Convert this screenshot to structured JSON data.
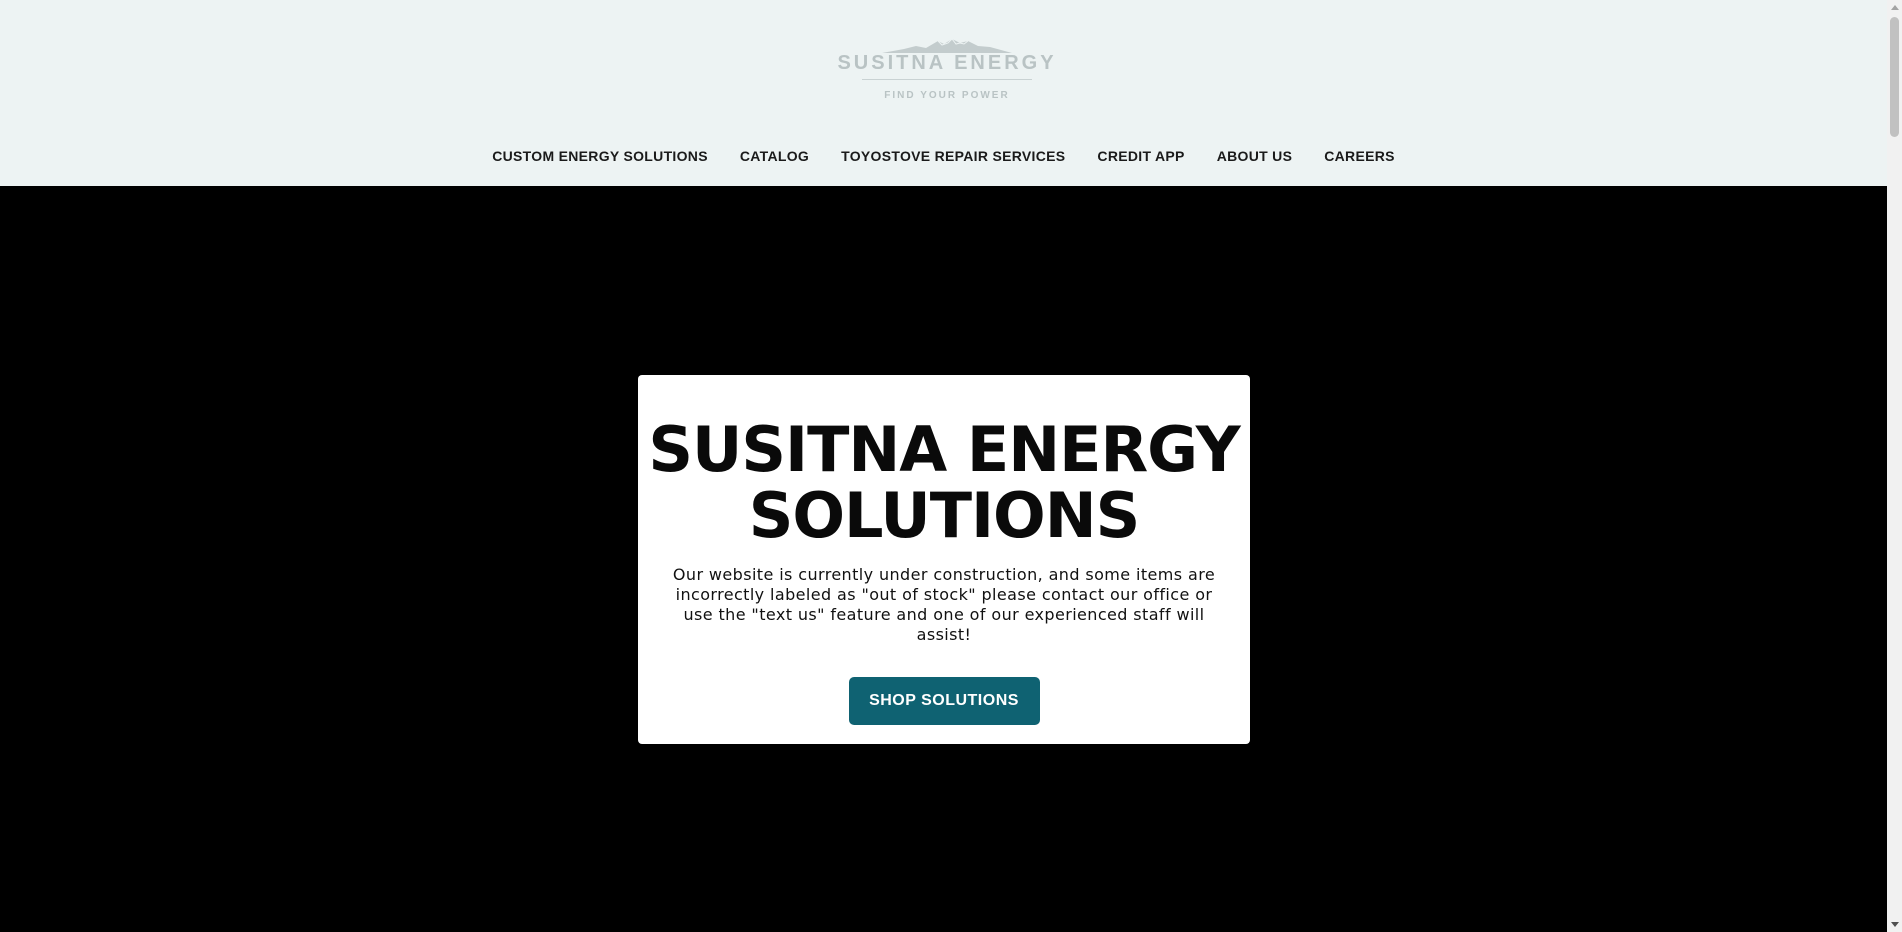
{
  "header": {
    "logo": {
      "name": "SUSITNA ENERGY",
      "tagline": "FIND YOUR POWER"
    },
    "nav": [
      {
        "label": "CUSTOM ENERGY SOLUTIONS"
      },
      {
        "label": "CATALOG"
      },
      {
        "label": "TOYOSTOVE REPAIR SERVICES"
      },
      {
        "label": "CREDIT APP"
      },
      {
        "label": "ABOUT US"
      },
      {
        "label": "CAREERS"
      }
    ]
  },
  "hero": {
    "title": "SUSITNA ENERGY SOLUTIONS",
    "message": "Our website is currently under construction, and some items are incorrectly labeled as \"out of stock\" please contact our office or use the \"text us\" feature and one of our experienced staff will assist!",
    "cta_label": "SHOP SOLUTIONS"
  },
  "colors": {
    "header_bg": "#edf3f3",
    "hero_bg": "#000000",
    "button_bg": "#0f6272",
    "button_text": "#ffffff"
  },
  "icons": {
    "logo_mark": "mountain-icon",
    "scroll_up": "arrow-up-icon",
    "scroll_down": "arrow-down-icon"
  }
}
